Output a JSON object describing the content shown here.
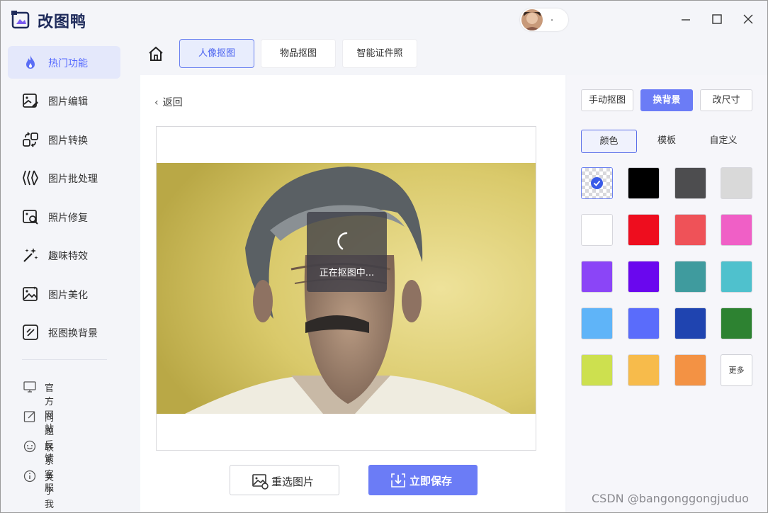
{
  "app": {
    "name": "改图鸭",
    "avatar_label": "."
  },
  "sidebar": {
    "items": [
      {
        "label": "热门功能",
        "icon": "flame-icon"
      },
      {
        "label": "图片编辑",
        "icon": "image-edit-icon"
      },
      {
        "label": "图片转换",
        "icon": "convert-icon"
      },
      {
        "label": "图片批处理",
        "icon": "batch-icon"
      },
      {
        "label": "照片修复",
        "icon": "photo-repair-icon"
      },
      {
        "label": "趣味特效",
        "icon": "magic-wand-icon"
      },
      {
        "label": "图片美化",
        "icon": "image-beautify-icon"
      },
      {
        "label": "抠图换背景",
        "icon": "cutout-icon"
      }
    ],
    "footer": [
      {
        "label": "官方网站",
        "icon": "monitor-icon"
      },
      {
        "label": "问题反馈",
        "icon": "feedback-icon"
      },
      {
        "label": "联系客服",
        "icon": "customer-service-icon"
      },
      {
        "label": "关于我们",
        "icon": "info-icon"
      }
    ]
  },
  "tabs": [
    {
      "label": "人像抠图"
    },
    {
      "label": "物品抠图"
    },
    {
      "label": "智能证件照"
    }
  ],
  "main": {
    "back_label": "返回",
    "loading_text": "正在抠图中...",
    "reselect_label": "重选图片",
    "save_label": "立即保存"
  },
  "right_panel": {
    "modes": [
      {
        "label": "手动抠图"
      },
      {
        "label": "换背景"
      },
      {
        "label": "改尺寸"
      }
    ],
    "sub_tabs": [
      {
        "label": "颜色"
      },
      {
        "label": "模板"
      },
      {
        "label": "自定义"
      }
    ],
    "colors": [
      "transparent",
      "#000000",
      "#4d4d4f",
      "#d9d9d9",
      "#ffffff",
      "#ee0d1e",
      "#ef5258",
      "#f05fc6",
      "#8b45f7",
      "#6a07ee",
      "#3f9b9e",
      "#4fc1cd",
      "#5fb4f8",
      "#5a6cfb",
      "#1f44b0",
      "#2d8231",
      "#cde04f",
      "#f7bb4b",
      "#f39244"
    ],
    "more_label": "更多"
  },
  "watermark": "CSDN @bangonggongjuduo"
}
